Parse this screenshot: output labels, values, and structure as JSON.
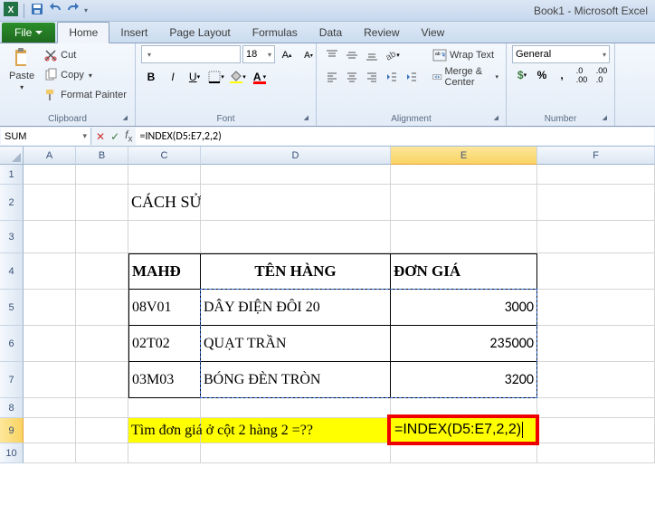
{
  "app_title": "Book1 - Microsoft Excel",
  "tabs": {
    "file": "File",
    "home": "Home",
    "insert": "Insert",
    "page_layout": "Page Layout",
    "formulas": "Formulas",
    "data": "Data",
    "review": "Review",
    "view": "View"
  },
  "ribbon": {
    "clipboard": {
      "paste": "Paste",
      "cut": "Cut",
      "copy": "Copy",
      "format_painter": "Format Painter",
      "label": "Clipboard"
    },
    "font": {
      "family": "",
      "size": "18",
      "label": "Font"
    },
    "alignment": {
      "wrap": "Wrap Text",
      "merge": "Merge & Center",
      "label": "Alignment"
    },
    "number": {
      "format": "General",
      "label": "Number"
    }
  },
  "namebox": "SUM",
  "formula": "=INDEX(D5:E7,2,2)",
  "cols": {
    "A": 58,
    "B": 58,
    "C": 80,
    "D": 210,
    "E": 162,
    "F": 60
  },
  "rows": {
    "1": 22,
    "2": 40,
    "3": 36,
    "4": 40,
    "5": 40,
    "6": 40,
    "7": 40,
    "8": 22,
    "9": 28,
    "10": 22
  },
  "cells": {
    "C2": "CÁCH SỬ DỤNG HÀM INDEX",
    "C4": "MAHĐ",
    "D4": "TÊN HÀNG",
    "E4": "ĐƠN GIÁ",
    "C5": "08V01",
    "D5": "DÂY ĐIỆN ĐÔI 20",
    "E5": "3000",
    "C6": "02T02",
    "D6": "QUẠT TRẦN",
    "E6": "235000",
    "C7": "03M03",
    "D7": "BÓNG ĐÈN TRÒN",
    "E7": "3200",
    "C9": "Tìm đơn giá ở cột 2 hàng 2 =??",
    "E9": "=INDEX(D5:E7,2,2)"
  },
  "active_cell": "E9"
}
